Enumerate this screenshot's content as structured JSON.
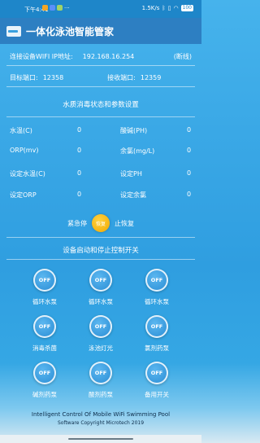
{
  "status_bar": {
    "time": "下午4:41",
    "network_speed": "1.5K/s",
    "battery": "100",
    "colors": [
      "#f5a623",
      "#5b8ff9",
      "#a0d468"
    ]
  },
  "app": {
    "title": "一体化泳池智能管家"
  },
  "connection": {
    "wifi_label": "连接设备WIFI IP地址:",
    "ip": "192.168.16.254",
    "status": "(断线)",
    "target_port_label": "目标端口:",
    "target_port": "12358",
    "receive_port_label": "接收端口:",
    "receive_port": "12359"
  },
  "params": {
    "title": "水质消毒状态和参数设置",
    "water_temp_label": "水温(C)",
    "water_temp": "0",
    "ph_label": "酸碱(PH)",
    "ph": "0",
    "orp_label": "ORP(mv)",
    "orp": "0",
    "chlorine_label": "余氯(mg/L)",
    "chlorine": "0",
    "set_temp_label": "设定水温(C)",
    "set_temp": "0",
    "set_ph_label": "设定PH",
    "set_ph": "0",
    "set_orp_label": "设定ORP",
    "set_orp": "0",
    "set_chlorine_label": "设定余氯",
    "set_chlorine": "0"
  },
  "estop": {
    "left_label": "紧急停",
    "button_label": "恢复",
    "right_label": "止恢复"
  },
  "controls": {
    "title": "设备启动和停止控制开关",
    "items": [
      {
        "state": "OFF",
        "label": "循环水泵"
      },
      {
        "state": "OFF",
        "label": "循环水泵"
      },
      {
        "state": "OFF",
        "label": "循环水泵"
      },
      {
        "state": "OFF",
        "label": "消毒杀菌"
      },
      {
        "state": "OFF",
        "label": "泳池灯光"
      },
      {
        "state": "OFF",
        "label": "氯剂药泵"
      },
      {
        "state": "OFF",
        "label": "碱剂药泵"
      },
      {
        "state": "OFF",
        "label": "酸剂药泵"
      },
      {
        "state": "OFF",
        "label": "备用开关"
      }
    ]
  },
  "footer": {
    "line1": "Intelligent Control Of Mobile WiFi Swimming Pool",
    "line2": "Software Copyright Microtech 2019"
  }
}
